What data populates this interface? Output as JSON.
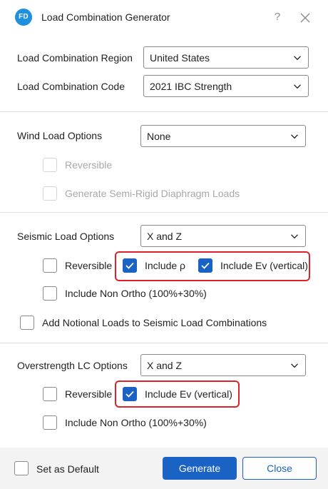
{
  "window": {
    "logo_text": "FD",
    "title": "Load Combination Generator",
    "help_label": "?"
  },
  "region": {
    "region_label": "Load Combination Region",
    "region_value": "United States",
    "code_label": "Load Combination Code",
    "code_value": "2021 IBC Strength"
  },
  "wind": {
    "label": "Wind Load Options",
    "value": "None",
    "reversible_label": "Reversible",
    "reversible_checked": false,
    "semi_rigid_label": "Generate Semi-Rigid Diaphragm Loads",
    "semi_rigid_checked": false
  },
  "seismic": {
    "label": "Seismic Load Options",
    "value": "X and Z",
    "reversible_label": "Reversible",
    "reversible_checked": false,
    "include_rho_label": "Include ρ",
    "include_rho_checked": true,
    "include_ev_label": "Include Ev (vertical)",
    "include_ev_checked": true,
    "non_ortho_label": "Include Non Ortho (100%+30%)",
    "non_ortho_checked": false,
    "notional_label": "Add Notional Loads to Seismic Load Combinations",
    "notional_checked": false
  },
  "overstrength": {
    "label": "Overstrength LC Options",
    "value": "X and Z",
    "reversible_label": "Reversible",
    "reversible_checked": false,
    "include_ev_label": "Include Ev (vertical)",
    "include_ev_checked": true,
    "non_ortho_label": "Include Non Ortho (100%+30%)",
    "non_ortho_checked": false
  },
  "footer": {
    "default_label": "Set as Default",
    "default_checked": false,
    "generate_label": "Generate",
    "close_label": "Close"
  },
  "colors": {
    "accent": "#1a62c4",
    "highlight": "#e0202a",
    "logo": "#1f8fe0"
  }
}
